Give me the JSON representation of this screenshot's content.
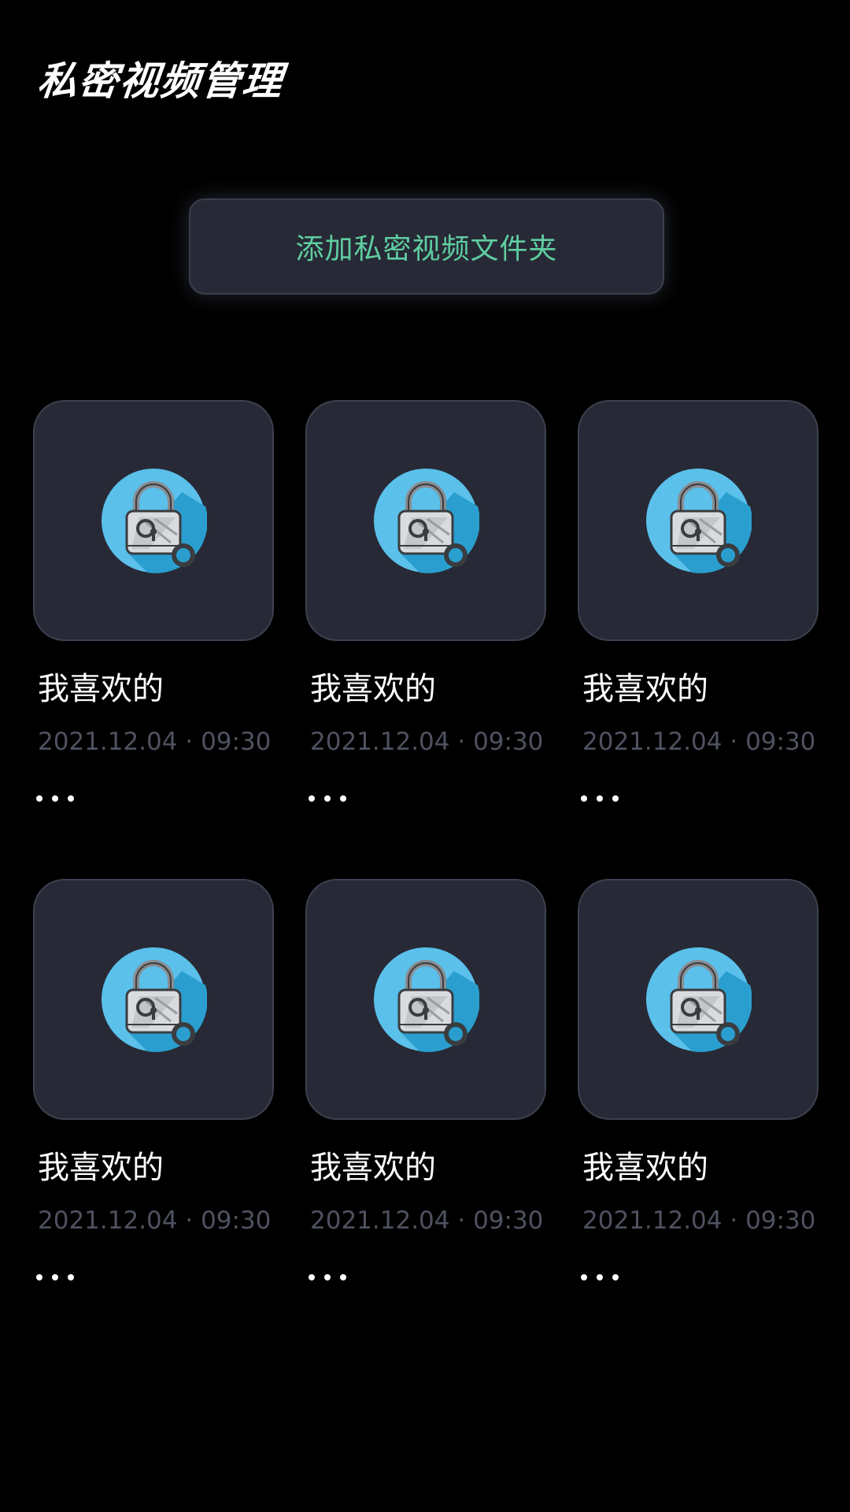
{
  "header": {
    "title": "私密视频管理"
  },
  "add_button": {
    "label": "添加私密视频文件夹",
    "color": "#5fcea0"
  },
  "folders": [
    {
      "name": "我喜欢的",
      "date": "2021.12.04",
      "time": "09:30",
      "icon": "lock-icon",
      "more_icon": "more-icon"
    },
    {
      "name": "我喜欢的",
      "date": "2021.12.04",
      "time": "09:30",
      "icon": "lock-icon",
      "more_icon": "more-icon"
    },
    {
      "name": "我喜欢的",
      "date": "2021.12.04",
      "time": "09:30",
      "icon": "lock-icon",
      "more_icon": "more-icon"
    },
    {
      "name": "我喜欢的",
      "date": "2021.12.04",
      "time": "09:30",
      "icon": "lock-icon",
      "more_icon": "more-icon"
    },
    {
      "name": "我喜欢的",
      "date": "2021.12.04",
      "time": "09:30",
      "icon": "lock-icon",
      "more_icon": "more-icon"
    },
    {
      "name": "我喜欢的",
      "date": "2021.12.04",
      "time": "09:30",
      "icon": "lock-icon",
      "more_icon": "more-icon"
    }
  ],
  "colors": {
    "background": "#000000",
    "card": "#272a36",
    "date_text": "#4f5260",
    "lock_circle": "#5bc0ea",
    "lock_shadow": "#2a9fcf"
  }
}
